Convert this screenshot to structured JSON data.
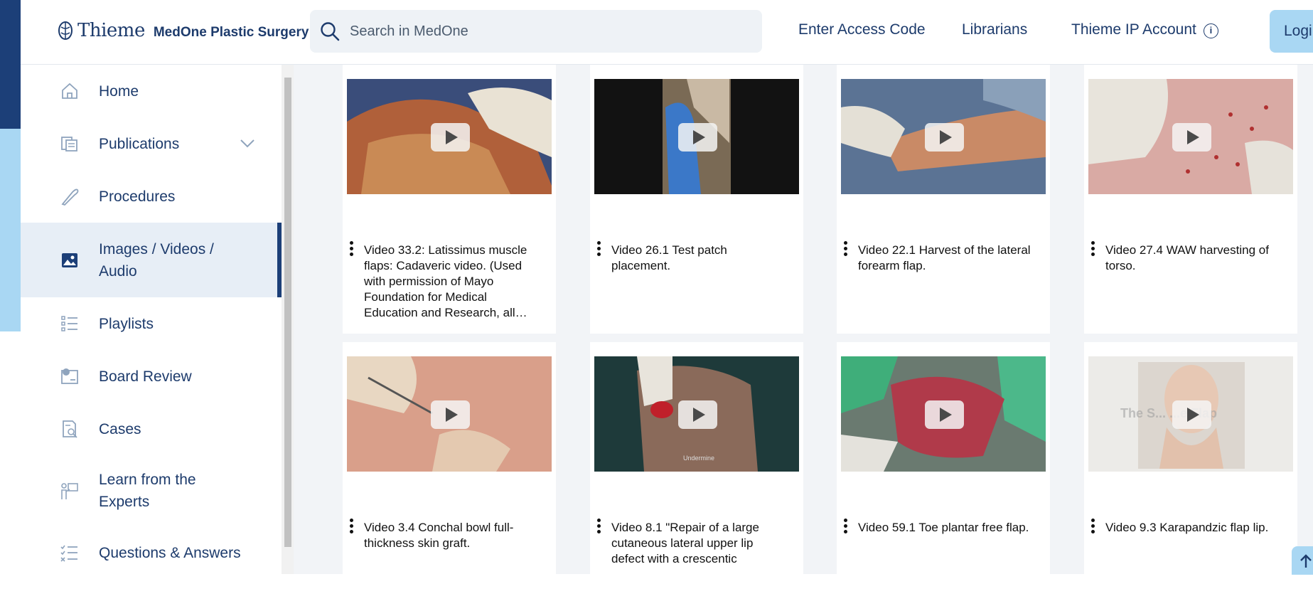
{
  "header": {
    "brand": "Thieme",
    "product": "MedOne Plastic Surgery",
    "search_placeholder": "Search in MedOne",
    "links": [
      "Enter Access Code",
      "Librarians",
      "Thieme IP Account"
    ],
    "info_icon": "i",
    "login": "Login"
  },
  "sidebar": {
    "items": [
      {
        "label": "Home",
        "icon": "home-icon"
      },
      {
        "label": "Publications",
        "icon": "books-icon"
      },
      {
        "label": "Procedures",
        "icon": "scalpel-icon"
      },
      {
        "label": "Images / Videos / Audio",
        "icon": "image-icon",
        "active": true
      },
      {
        "label": "Playlists",
        "icon": "list-icon"
      },
      {
        "label": "Board Review",
        "icon": "clock-board-icon"
      },
      {
        "label": "Cases",
        "icon": "case-icon"
      },
      {
        "label": "Learn from the Experts",
        "icon": "presenter-icon"
      },
      {
        "label": "Questions & Answers",
        "icon": "checklist-icon"
      }
    ]
  },
  "videos": [
    {
      "title": "Video 33.2: Latissimus muscle flaps: Cadaveric video. (Used with permission of Mayo Foundation for Medical Education and Research, all…"
    },
    {
      "title": "Video 26.1 Test patch placement."
    },
    {
      "title": "Video 22.1 Harvest of the lateral forearm flap."
    },
    {
      "title": "Video 27.4 WAW harvesting of torso."
    },
    {
      "title": "Video 3.4 Conchal bowl full-thickness skin graft."
    },
    {
      "title": "Video 8.1 \"Repair of a large cutaneous lateral upper lip defect with a crescentic"
    },
    {
      "title": "Video 59.1 Toe plantar free flap."
    },
    {
      "title": "Video 9.3 Karapandzic flap lip."
    }
  ],
  "thumb_overlays": {
    "video6": "Undermine",
    "video8": "The S... ...e Flap"
  },
  "colors": {
    "navy": "#1c3f78",
    "light_blue": "#a9d7f3",
    "text": "#1d3b6c"
  }
}
